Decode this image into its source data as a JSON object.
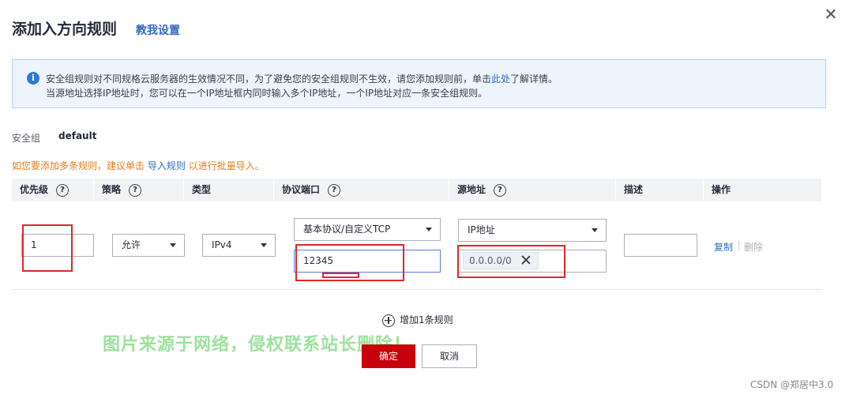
{
  "dialog": {
    "title": "添加入方向规则",
    "help_link": "教我设置"
  },
  "info": {
    "line1_prefix": "安全组规则对不同规格云服务器的生效情况不同，为了避免您的安全组规则不生效，请您添加规则前，单击",
    "line1_link": "此处",
    "line1_suffix": "了解详情。",
    "line2": "当源地址选择IP地址时，您可以在一个IP地址框内同时输入多个IP地址，一个IP地址对应一条安全组规则。"
  },
  "security_group": {
    "label": "安全组",
    "value": "default"
  },
  "tip": {
    "prefix": "如您要添加多条规则，建议单击 ",
    "link": "导入规则",
    "suffix": " 以进行批量导入。"
  },
  "table": {
    "headers": {
      "priority": "优先级",
      "policy": "策略",
      "type": "类型",
      "protocol_port": "协议端口",
      "source": "源地址",
      "description": "描述",
      "action": "操作"
    },
    "help_glyph": "?",
    "row": {
      "priority": "1",
      "policy": "允许",
      "type": "IPv4",
      "protocol": "基本协议/自定义TCP",
      "port": "12345",
      "source_type": "IP地址",
      "source_tag": "0.0.0.0/0",
      "description": "",
      "copy": "复制",
      "delete": "删除"
    }
  },
  "add_rule": "增加1条规则",
  "buttons": {
    "ok": "确定",
    "cancel": "取消"
  },
  "watermark": "图片来源于网络，侵权联系站长删除！",
  "credit": "CSDN @郑居中3.0",
  "colors": {
    "primary_button": "#c7000b",
    "link": "#2d6ec5",
    "tip": "#e37f1e",
    "annotation": "#e1262c"
  }
}
